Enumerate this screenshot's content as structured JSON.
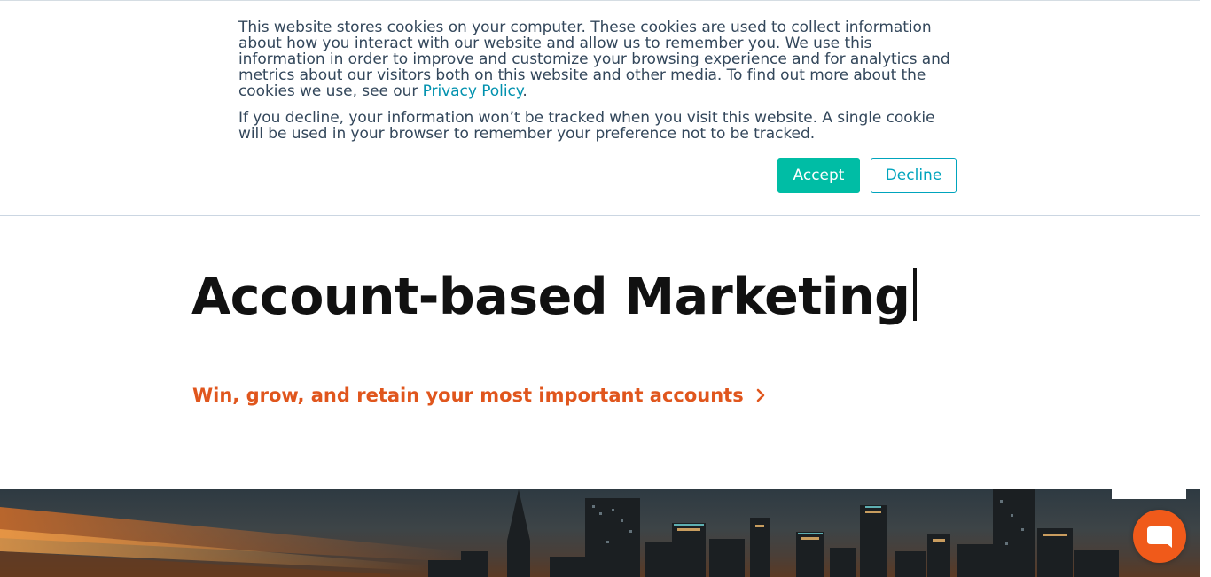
{
  "cookie_banner": {
    "paragraph1_text": "This website stores cookies on your computer. These cookies are used to collect information about how you interact with our website and allow us to remember you. We use this information in order to improve and customize your browsing experience and for analytics and metrics about our visitors both on this website and other media. To find out more about the cookies we use, see our ",
    "privacy_link": "Privacy Policy",
    "paragraph1_end": ".",
    "paragraph2_text": "If you decline, your information won’t be tracked when you visit this website. A single cookie will be used in your browser to remember your preference not to be tracked.",
    "accept_label": "Accept",
    "decline_label": "Decline"
  },
  "hero": {
    "title": "Account-based Marketing",
    "link_text": "Win, grow, and retain your most important accounts"
  },
  "chat": {
    "icon": "chat-bubble-icon"
  },
  "colors": {
    "accent_teal": "#00bda5",
    "link_teal": "#0091ae",
    "orange": "#e0561d",
    "chat_orange": "#f05a1a"
  }
}
